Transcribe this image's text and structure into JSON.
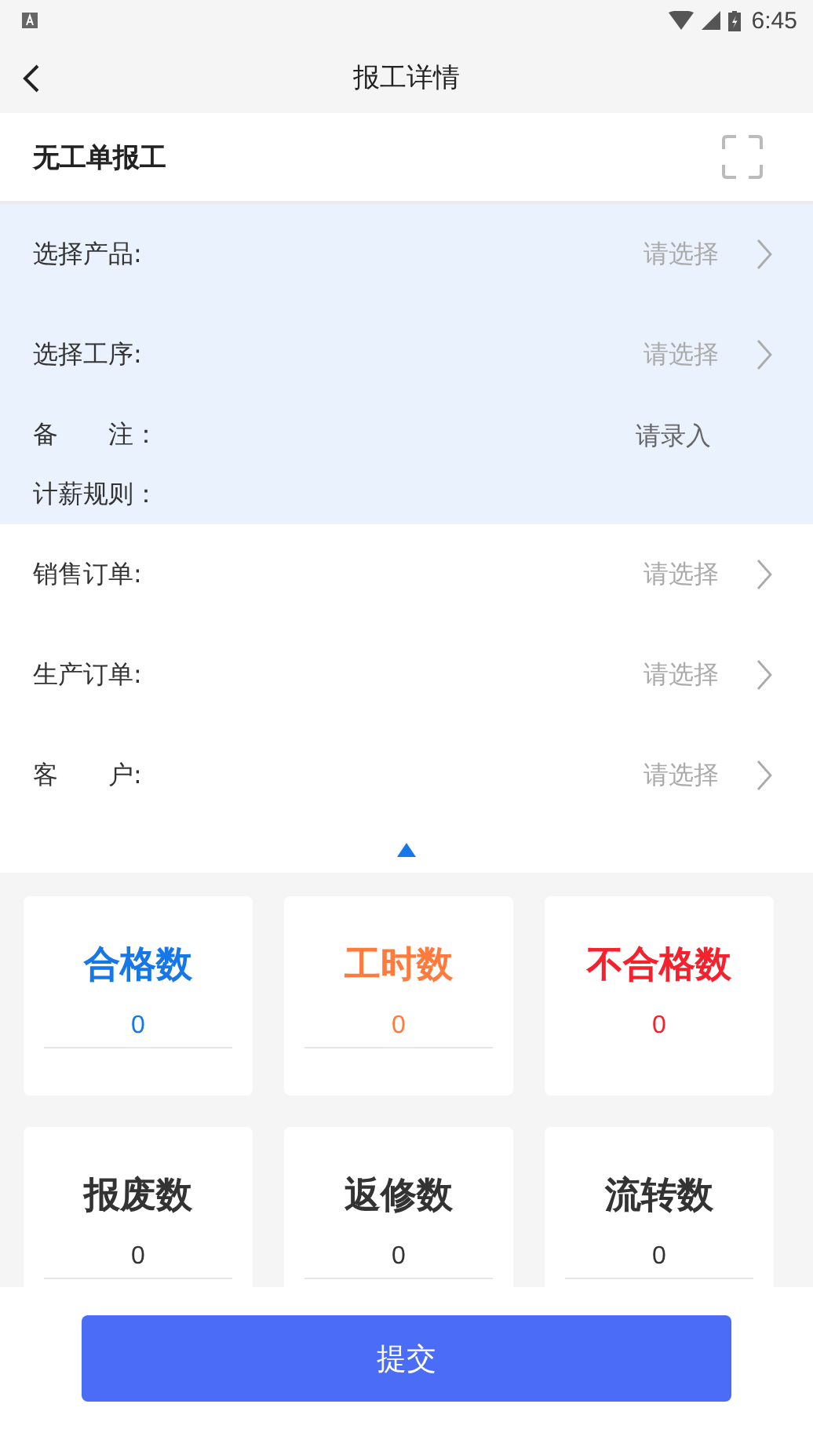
{
  "status_bar": {
    "time": "6:45"
  },
  "nav": {
    "title": "报工详情"
  },
  "header": {
    "title": "无工单报工"
  },
  "rows": [
    {
      "label": "选择产品:",
      "kind": "select",
      "placeholder": "请选择",
      "highlighted": true
    },
    {
      "label": "选择工序:",
      "kind": "select",
      "placeholder": "请选择",
      "highlighted": true
    },
    {
      "label": "备　　注：",
      "kind": "input",
      "placeholder": "请录入",
      "highlighted": true
    },
    {
      "label": "计薪规则：",
      "kind": "label",
      "highlighted": true
    },
    {
      "label": "销售订单:",
      "kind": "select",
      "placeholder": "请选择",
      "highlighted": false
    },
    {
      "label": "生产订单:",
      "kind": "select",
      "placeholder": "请选择",
      "highlighted": false
    },
    {
      "label": "客　　户:",
      "kind": "select",
      "placeholder": "请选择",
      "highlighted": false
    }
  ],
  "expanded": true,
  "cards": [
    {
      "title": "合格数",
      "value": "0",
      "color": "#1677e8",
      "field": true
    },
    {
      "title": "工时数",
      "value": "0",
      "color": "#ff7a3d",
      "field": true
    },
    {
      "title": "不合格数",
      "value": "0",
      "color": "#f5222d",
      "field": false
    },
    {
      "title": "报废数",
      "value": "0",
      "color": "#333333",
      "field": true
    },
    {
      "title": "返修数",
      "value": "0",
      "color": "#333333",
      "field": true
    },
    {
      "title": "流转数",
      "value": "0",
      "color": "#333333",
      "field": true
    }
  ],
  "submit": {
    "label": "提交"
  }
}
